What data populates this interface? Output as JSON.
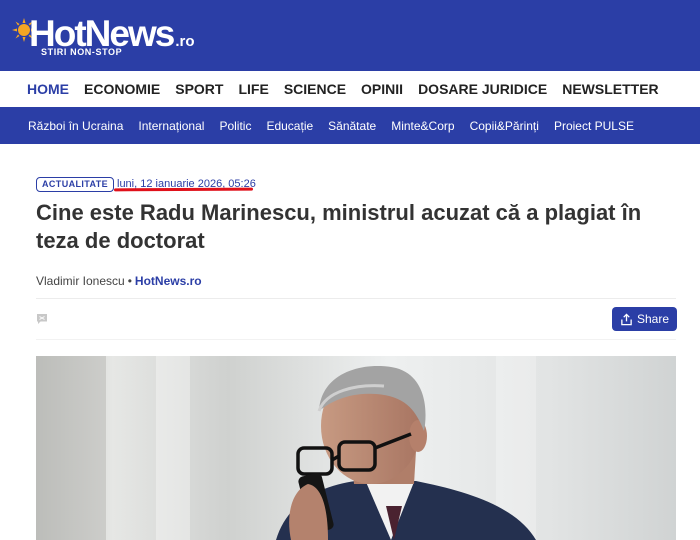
{
  "header": {
    "logo_text": "HotNews",
    "logo_suffix": ".ro",
    "tagline": "STIRI NON-STOP"
  },
  "main_nav": [
    {
      "label": "HOME"
    },
    {
      "label": "ECONOMIE"
    },
    {
      "label": "SPORT"
    },
    {
      "label": "LIFE"
    },
    {
      "label": "SCIENCE"
    },
    {
      "label": "OPINII"
    },
    {
      "label": "DOSARE JURIDICE"
    },
    {
      "label": "NEWSLETTER"
    }
  ],
  "sub_nav": [
    {
      "label": "Război în Ucraina"
    },
    {
      "label": "Internațional"
    },
    {
      "label": "Politic"
    },
    {
      "label": "Educație"
    },
    {
      "label": "Sănătate"
    },
    {
      "label": "Minte&Corp"
    },
    {
      "label": "Copii&Părinți"
    },
    {
      "label": "Proiect PULSE"
    }
  ],
  "article": {
    "category": "ACTUALITATE",
    "date": "luni, 12 ianuarie 2026, 05:26",
    "title": "Cine este Radu Marinescu, ministrul acuzat că a plagiat în teza de doctorat",
    "author": "Vladimir Ionescu",
    "separator": "•",
    "source": "HotNews.ro",
    "share_label": "Share"
  },
  "colors": {
    "brand_blue": "#2b3ea6",
    "logo_sun": "#f5a623",
    "date_underline": "#e0101a"
  },
  "icons": {
    "comment": "comment-icon",
    "share": "share-upload-icon",
    "sun": "sun-logo-icon"
  }
}
